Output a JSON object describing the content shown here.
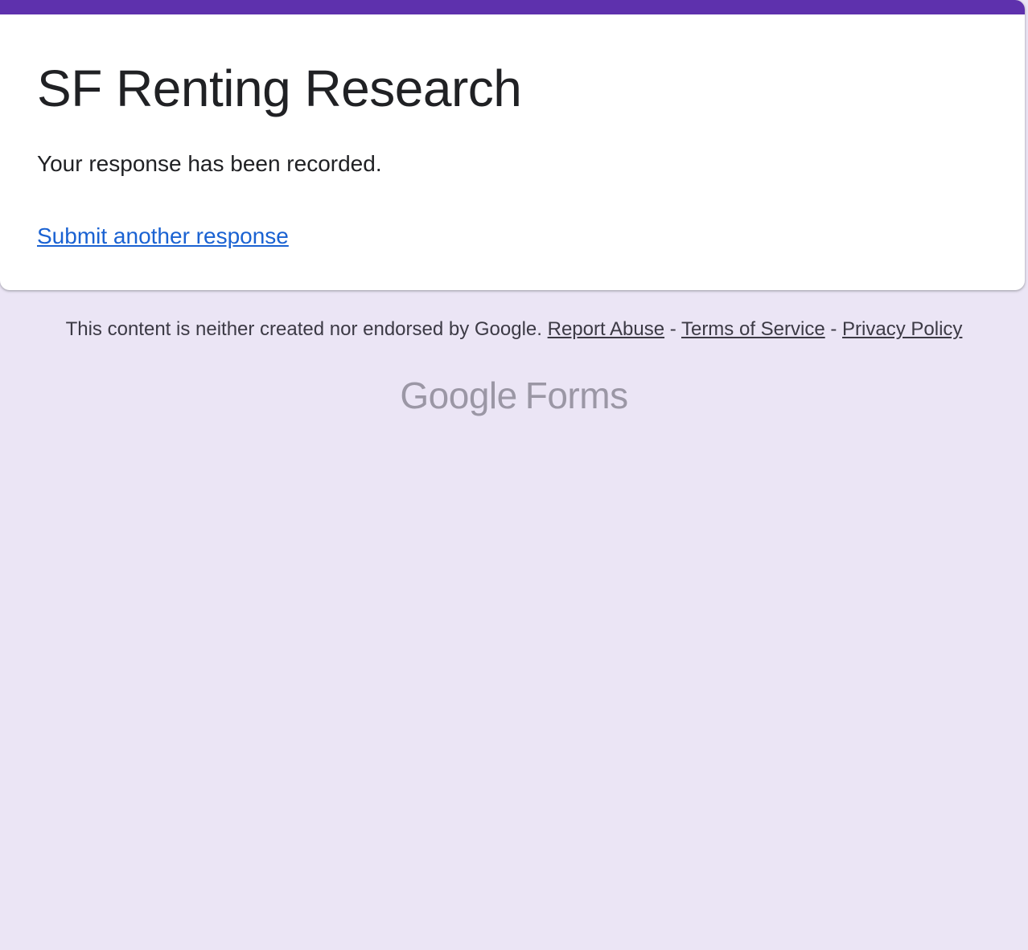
{
  "form": {
    "title": "SF Renting Research",
    "confirmation": "Your response has been recorded.",
    "another_response_link": "Submit another response"
  },
  "footer": {
    "disclaimer": "This content is neither created nor endorsed by Google.",
    "separator": "-",
    "links": [
      "Report Abuse",
      "Terms of Service",
      "Privacy Policy"
    ]
  },
  "branding": {
    "logo_google": "Google",
    "logo_product": "Forms"
  },
  "colors": {
    "accent": "#5e31ad",
    "background": "#ebe5f5",
    "link": "#1a62d2",
    "logo": "#9b97a5"
  }
}
